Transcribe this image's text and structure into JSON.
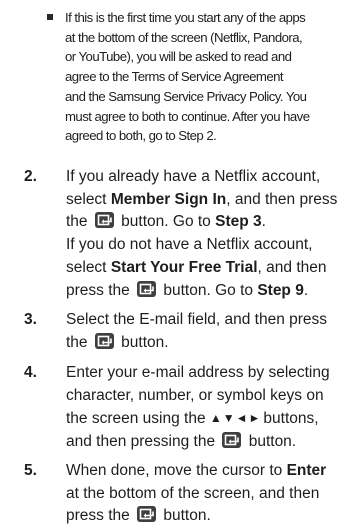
{
  "bullet": {
    "lines": [
      "If this is the first time you start any of the apps",
      "at the bottom of the screen (Netflix, Pandora,",
      "or YouTube), you will be asked to read and",
      "agree to the Terms of Service Agreement",
      "and the Samsung Service Privacy Policy. You",
      "must agree to both to continue. After you have",
      "agreed to both, go to Step 2."
    ]
  },
  "steps": {
    "s2": {
      "number": "2.",
      "l1": "If you already have a Netflix account,",
      "l2a": "select ",
      "l2b": "Member Sign In",
      "l2c": ", and then press",
      "l3a": "the",
      "l3b": " button. Go to ",
      "l3c": "Step 3",
      "l3d": ".",
      "l4": "If you do not have a Netflix account,",
      "l5a": "select ",
      "l5b": "Start Your Free Trial",
      "l5c": ", and then",
      "l6a": "press the",
      "l6b": " button. Go to ",
      "l6c": "Step 9",
      "l6d": "."
    },
    "s3": {
      "number": "3.",
      "l1": "Select the E-mail field, and then press",
      "l2a": "the",
      "l2b": " button."
    },
    "s4": {
      "number": "4.",
      "l1": "Enter your e-mail address by selecting",
      "l2": "character, number, or symbol keys on",
      "l3a": "the screen using the ",
      "l3b": "▲▼◄►",
      "l3c": "buttons,",
      "l4a": "and then pressing the",
      "l4b": " button."
    },
    "s5": {
      "number": "5.",
      "l1a": "When done, move the cursor to ",
      "l1b": "Enter",
      "l2": "at the bottom of the screen, and then",
      "l3a": "press the",
      "l3b": " button."
    }
  }
}
